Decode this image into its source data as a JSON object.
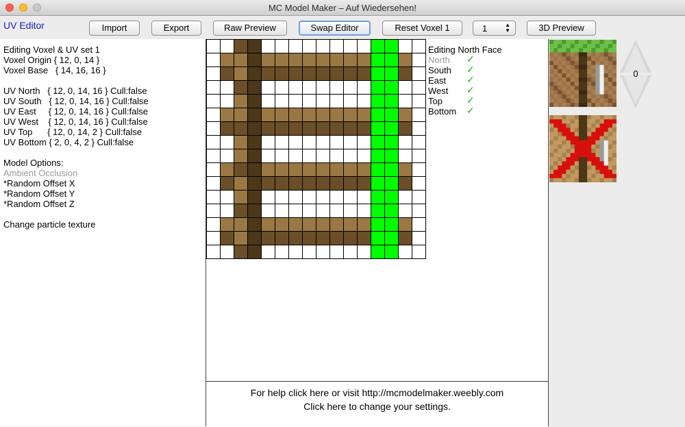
{
  "window": {
    "title": "MC Model Maker – Auf Wiedersehen!"
  },
  "header": {
    "uv_editor_label": "UV Editor"
  },
  "toolbar": {
    "import_label": "Import",
    "export_label": "Export",
    "raw_preview_label": "Raw Preview",
    "swap_editor_label": "Swap Editor",
    "reset_voxel_label": "Reset Voxel 1",
    "voxel_select_value": "1",
    "preview_3d_label": "3D Preview"
  },
  "info": {
    "editing": "Editing Voxel & UV set 1",
    "voxel_origin": "Voxel Origin { 12, 0, 14 }",
    "voxel_base": "Voxel Base   { 14, 16, 16 }",
    "uv_north": "UV North   { 12, 0, 14, 16 } Cull:false",
    "uv_south": "UV South   { 12, 0, 14, 16 } Cull:false",
    "uv_east": "UV East     { 12, 0, 14, 16 } Cull:false",
    "uv_west": "UV West    { 12, 0, 14, 16 } Cull:false",
    "uv_top": "UV Top      { 12, 0, 14, 2 } Cull:false",
    "uv_bottom": "UV Bottom { 2, 0, 4, 2 } Cull:false",
    "model_options": "Model Options:",
    "ambient_occlusion": "Ambient Occlusion",
    "random_offset_x": "*Random Offset X",
    "random_offset_y": "*Random Offset Y",
    "random_offset_z": "*Random Offset Z",
    "change_particle": "Change particle texture"
  },
  "faces": {
    "title": "Editing North Face",
    "items": [
      {
        "label": "North",
        "enabled": false
      },
      {
        "label": "South",
        "enabled": true
      },
      {
        "label": "East",
        "enabled": true
      },
      {
        "label": "West",
        "enabled": true
      },
      {
        "label": "Top",
        "enabled": true
      },
      {
        "label": "Bottom",
        "enabled": true
      }
    ],
    "check_glyph": "✓"
  },
  "footer": {
    "help_text": "For help click here or visit http://mcmodelmaker.weebly.com",
    "settings_text": "Click here to change your settings."
  },
  "texture_index": "0",
  "colors": {
    "uv_highlight": "#00ff00",
    "wood_dark": "#4c3719",
    "wood_mid": "#6b4f28",
    "wood_light": "#9a7844",
    "link_blue": "#1a1ac8",
    "cross_red": "#d8100c"
  }
}
